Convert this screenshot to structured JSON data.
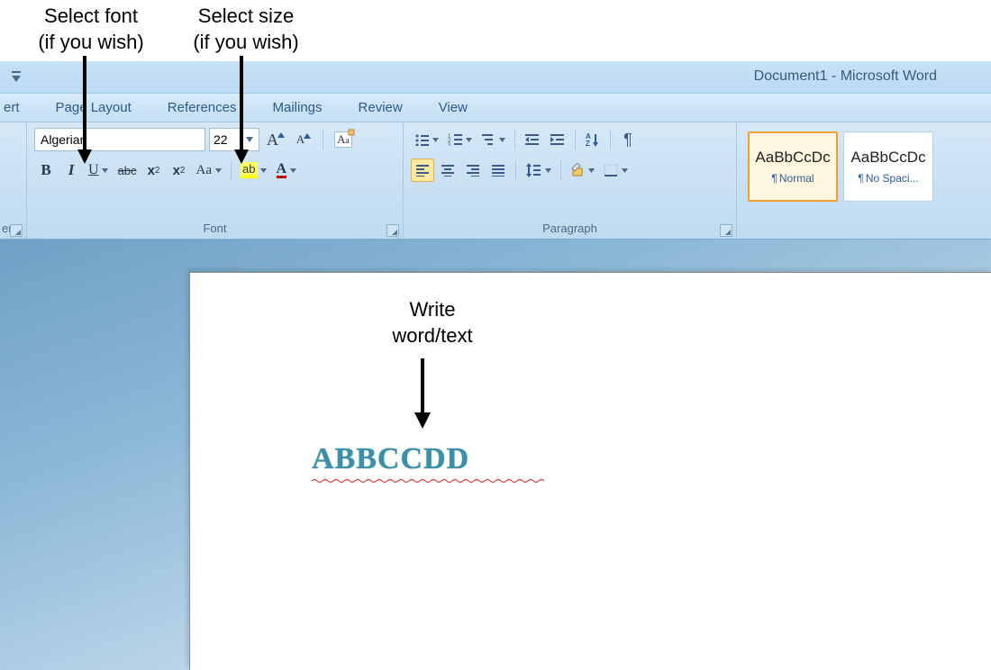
{
  "annotations": {
    "font_label_l1": "Select font",
    "font_label_l2": "(if you wish)",
    "size_label_l1": "Select size",
    "size_label_l2": "(if you wish)",
    "write_l1": "Write",
    "write_l2": "word/text"
  },
  "titlebar": {
    "title": "Document1 - Microsoft Word"
  },
  "tabs": {
    "insert_partial": "ert",
    "page_layout": "Page Layout",
    "references": "References",
    "mailings": "Mailings",
    "review": "Review",
    "view": "View"
  },
  "ribbon": {
    "clipboard_partial": "er",
    "font_group": "Font",
    "paragraph_group": "Paragraph",
    "font_name": "Algerian",
    "font_size": "22",
    "bold": "B",
    "italic": "I",
    "underline": "U",
    "strike": "abc",
    "sub": "x",
    "sup": "x",
    "case": "Aa",
    "highlight": "ab",
    "fontcolor": "A",
    "growfont": "A",
    "shrinkfont": "A",
    "clearfmt": "Aa"
  },
  "styles": {
    "sample1": "AaBbCcDc",
    "name1": "Normal",
    "sample2": "AaBbCcDc",
    "name2": "No Spaci..."
  },
  "document": {
    "text": "ABBCCDD"
  }
}
